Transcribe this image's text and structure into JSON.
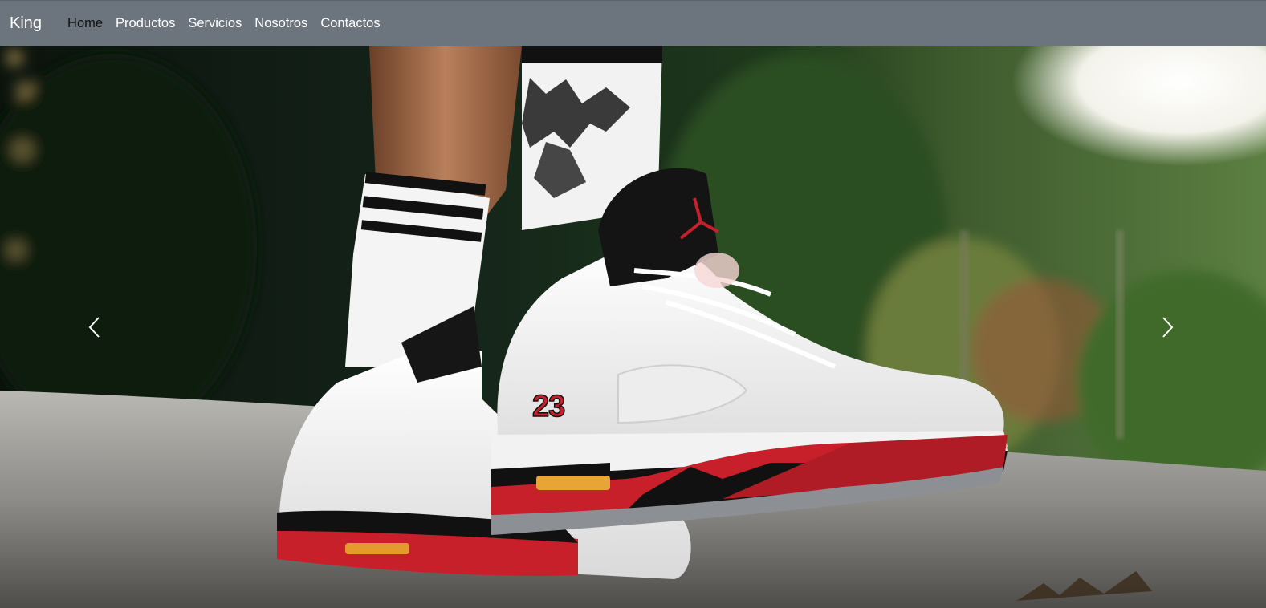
{
  "navbar": {
    "brand": "King",
    "links": [
      {
        "label": "Home",
        "active": true
      },
      {
        "label": "Productos",
        "active": false
      },
      {
        "label": "Servicios",
        "active": false
      },
      {
        "label": "Nosotros",
        "active": false
      },
      {
        "label": "Contactos",
        "active": false
      }
    ]
  },
  "carousel": {
    "prev_icon": "chevron-left-icon",
    "next_icon": "chevron-right-icon",
    "sneaker_number": "23"
  },
  "colors": {
    "navbar_bg": "#6c757d",
    "nav_active": "#111111",
    "nav_text": "#ffffff",
    "sneaker_red": "#c8202b"
  }
}
